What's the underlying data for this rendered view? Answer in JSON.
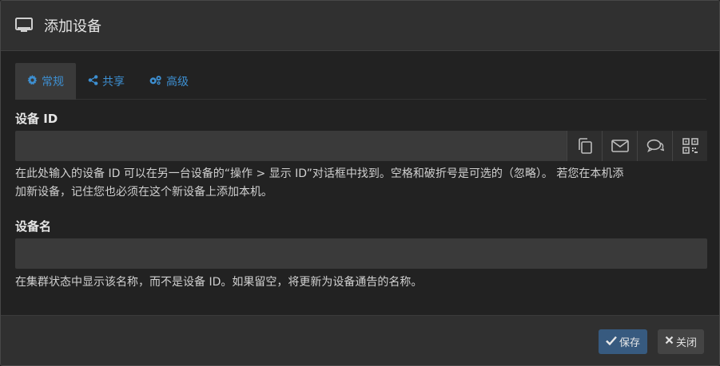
{
  "dialog": {
    "title": "添加设备",
    "title_icon": "monitor-icon"
  },
  "tabs": [
    {
      "label": "常规",
      "icon": "gear-icon",
      "active": true
    },
    {
      "label": "共享",
      "icon": "share-icon",
      "active": false
    },
    {
      "label": "高级",
      "icon": "gears-icon",
      "active": false
    }
  ],
  "device_id": {
    "label": "设备 ID",
    "value": "",
    "help_line1": "在此处输入的设备 ID 可以在另一台设备的“操作 > 显示 ID”对话框中找到。空格和破折号是可选的（忽略）。 若您在本机添",
    "help_line2": "加新设备，记住您也必须在这个新设备上添加本机。",
    "addons": [
      "copy-icon",
      "envelope-icon",
      "chat-icon",
      "qrcode-icon"
    ]
  },
  "device_name": {
    "label": "设备名",
    "value": "",
    "help": "在集群状态中显示该名称，而不是设备 ID。如果留空，将更新为设备通告的名称。"
  },
  "footer": {
    "save_label": "保存",
    "close_label": "关闭"
  },
  "colors": {
    "accent": "#3d8fd1",
    "primary_button": "#375a7f",
    "background": "#222222"
  }
}
